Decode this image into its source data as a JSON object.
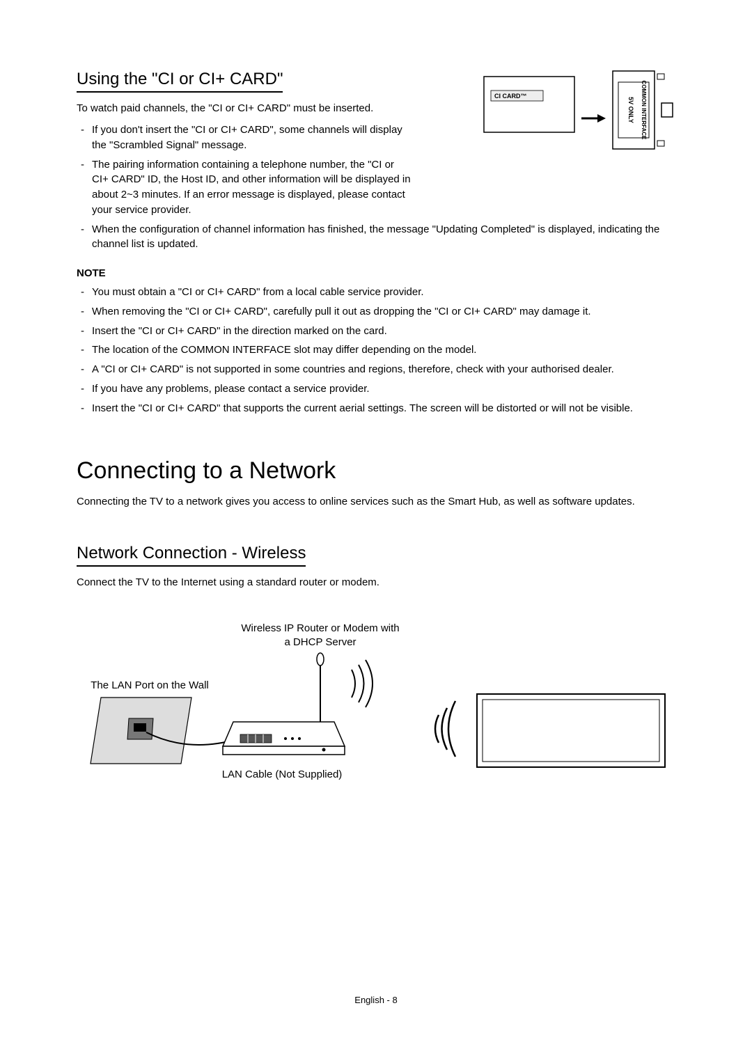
{
  "section1": {
    "heading": "Using the \"CI or CI+ CARD\"",
    "intro": "To watch paid channels, the \"CI or CI+ CARD\" must be inserted.",
    "bullets_top": [
      "If you don't insert the \"CI or CI+ CARD\", some channels will display the \"Scrambled Signal\" message.",
      "The pairing information containing a telephone number, the \"CI or CI+ CARD\" ID, the Host ID, and other information will be displayed in about 2~3 minutes. If an error message is displayed, please contact your service provider.",
      "When the configuration of channel information has finished, the message \"Updating Completed\" is displayed, indicating the channel list is updated."
    ],
    "note_heading": "NOTE",
    "bullets_note": [
      "You must obtain a \"CI or CI+ CARD\" from a local cable service provider.",
      "When removing the \"CI or CI+ CARD\", carefully pull it out as dropping the \"CI or CI+ CARD\" may damage it.",
      "Insert the \"CI or CI+ CARD\" in the direction marked on the card.",
      "The location of the COMMON INTERFACE slot may differ depending on the model.",
      "A \"CI or CI+ CARD\" is not supported in some countries and regions, therefore, check with your authorised dealer.",
      "If you have any problems, please contact a service provider.",
      "Insert the \"CI or CI+ CARD\" that supports the current aerial settings. The screen will be distorted or will not be visible."
    ],
    "diagram": {
      "ci_card_label": "CI CARD™",
      "slot_label": "COMMON INTERFACE",
      "voltage_label": "5V ONLY"
    }
  },
  "section2": {
    "heading": "Connecting to a Network",
    "intro": "Connecting the TV to a network gives you access to online services such as the Smart Hub, as well as software updates."
  },
  "section3": {
    "heading": "Network Connection - Wireless",
    "intro": "Connect the TV to the Internet using a standard router or modem.",
    "diagram": {
      "router_label_1": "Wireless IP Router or Modem with",
      "router_label_2": "a DHCP Server",
      "wall_label": "The LAN Port on the Wall",
      "cable_label": "LAN Cable (Not Supplied)"
    }
  },
  "footer": "English - 8"
}
